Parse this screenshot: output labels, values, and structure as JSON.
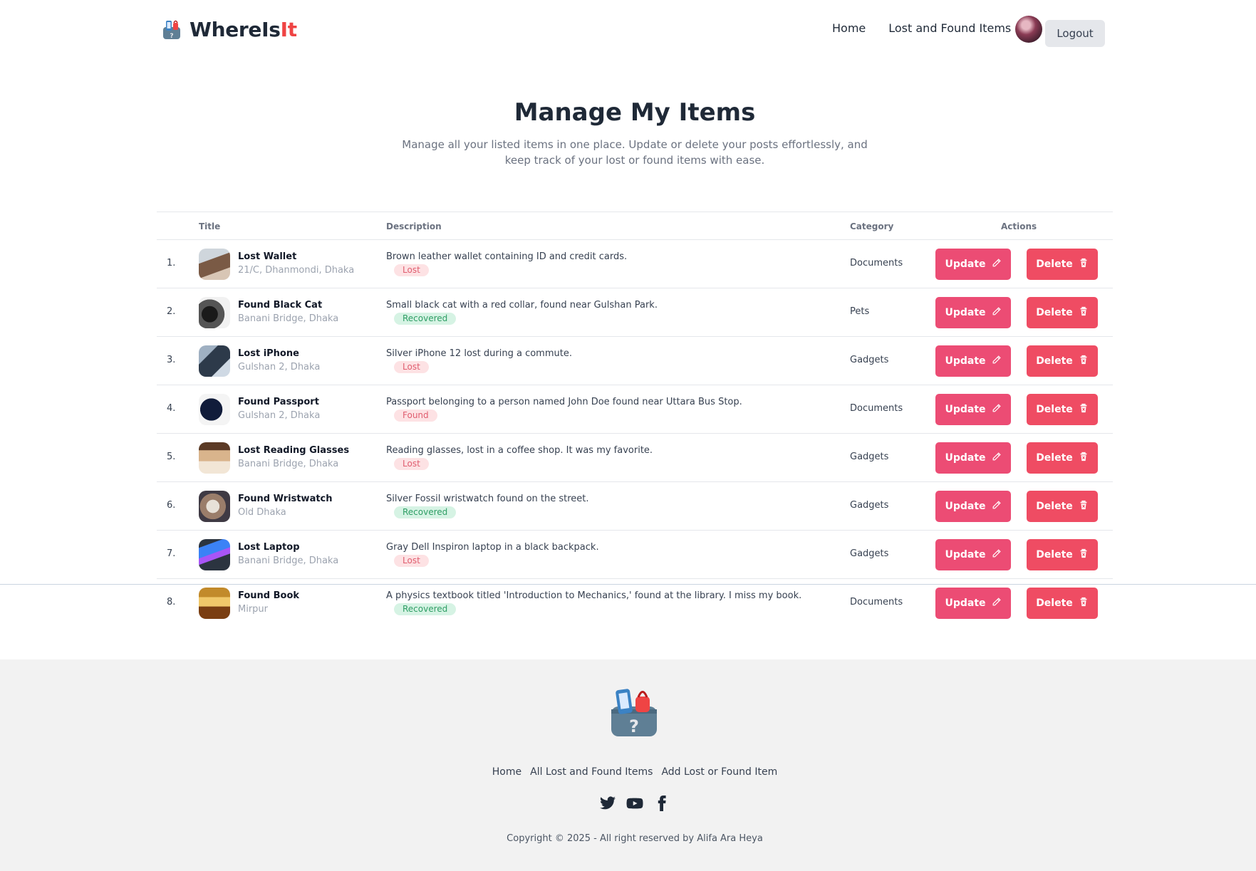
{
  "nav": {
    "brand_main": "WhereIs",
    "brand_accent": "It",
    "links": [
      "Home",
      "Lost and Found Items"
    ],
    "logout": "Logout"
  },
  "header": {
    "title": "Manage My Items",
    "subtitle": "Manage all your listed items in one place. Update or delete your posts effortlessly, and keep track of your lost or found items with ease."
  },
  "table": {
    "columns": [
      "Title",
      "Description",
      "Category",
      "Actions"
    ],
    "update_label": "Update",
    "delete_label": "Delete",
    "rows": [
      {
        "num": "1.",
        "title": "Lost Wallet",
        "location": "21/C, Dhanmondi, Dhaka",
        "description": "Brown leather wallet containing ID and credit cards.",
        "status": "Lost",
        "category": "Documents"
      },
      {
        "num": "2.",
        "title": "Found Black Cat",
        "location": "Banani Bridge, Dhaka",
        "description": "Small black cat with a red collar, found near Gulshan Park.",
        "status": "Recovered",
        "category": "Pets"
      },
      {
        "num": "3.",
        "title": "Lost iPhone",
        "location": "Gulshan 2, Dhaka",
        "description": "Silver iPhone 12 lost during a commute.",
        "status": "Lost",
        "category": "Gadgets"
      },
      {
        "num": "4.",
        "title": "Found Passport",
        "location": "Gulshan 2, Dhaka",
        "description": "Passport belonging to a person named John Doe found near Uttara Bus Stop.",
        "status": "Found",
        "category": "Documents"
      },
      {
        "num": "5.",
        "title": "Lost Reading Glasses",
        "location": "Banani Bridge, Dhaka",
        "description": "Reading glasses, lost in a coffee shop. It was my favorite.",
        "status": "Lost",
        "category": "Gadgets"
      },
      {
        "num": "6.",
        "title": "Found Wristwatch",
        "location": "Old Dhaka",
        "description": "Silver Fossil wristwatch found on the street.",
        "status": "Recovered",
        "category": "Gadgets"
      },
      {
        "num": "7.",
        "title": "Lost Laptop",
        "location": "Banani Bridge, Dhaka",
        "description": "Gray Dell Inspiron laptop in a black backpack.",
        "status": "Lost",
        "category": "Gadgets"
      },
      {
        "num": "8.",
        "title": "Found Book",
        "location": "Mirpur",
        "description": "A physics textbook titled 'Introduction to Mechanics,' found at the library. I miss my book.",
        "status": "Recovered",
        "category": "Documents"
      }
    ]
  },
  "footer": {
    "links": [
      "Home",
      "All Lost and Found Items",
      "Add Lost or Found Item"
    ],
    "social": [
      "twitter-icon",
      "youtube-icon",
      "facebook-icon"
    ],
    "copyright": "Copyright © 2025 - All right reserved by Alifa Ara Heya"
  },
  "colors": {
    "update_button": "#ec4c74",
    "delete_button": "#ef4c63",
    "brand_accent": "#ef4444",
    "footer_bg": "#f2f2f2"
  }
}
